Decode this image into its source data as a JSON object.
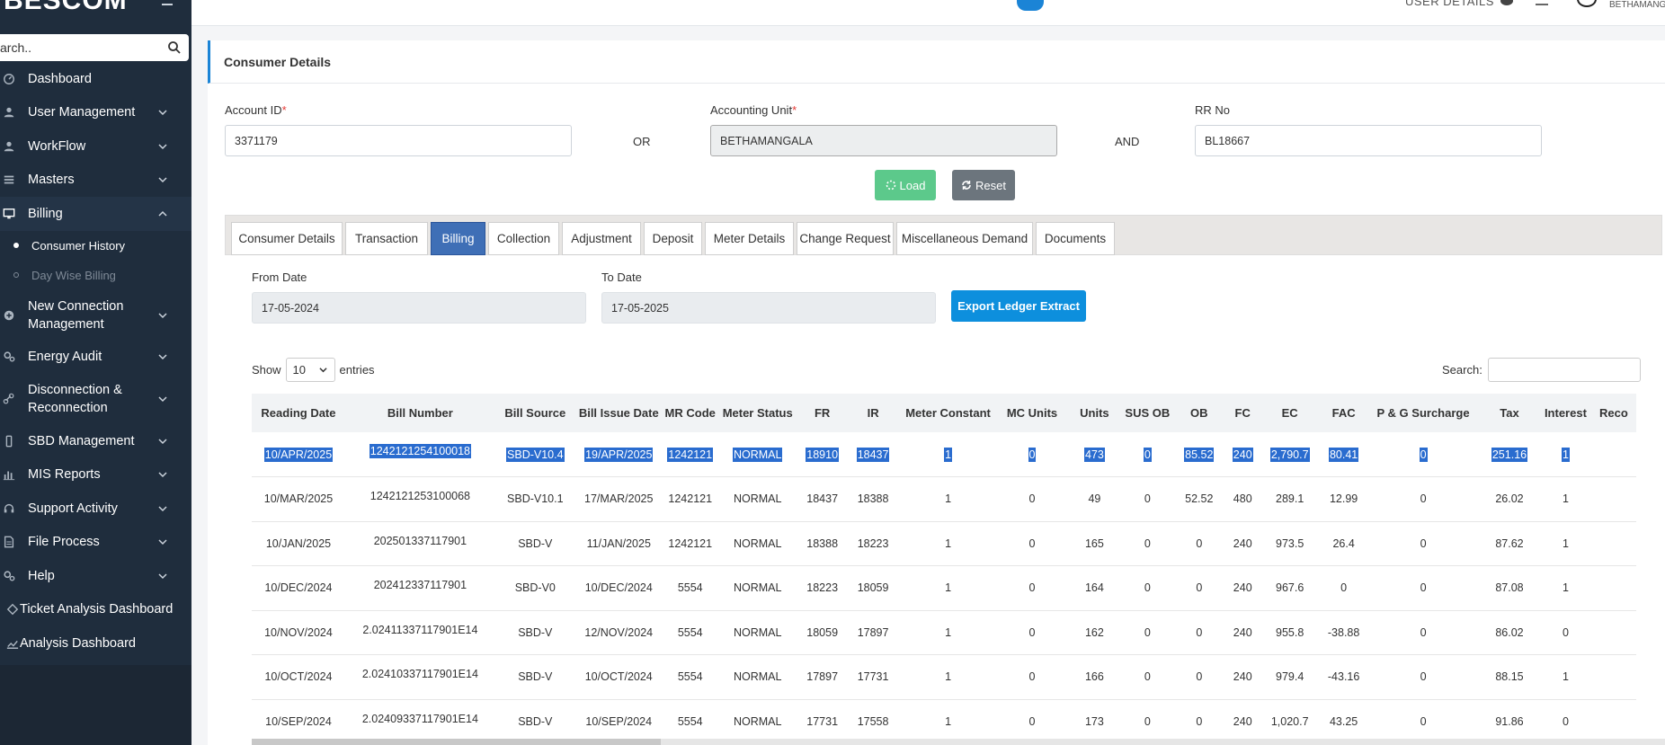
{
  "app": {
    "brand": "BESCOM",
    "search_placeholder": "Search..",
    "search_value": "arch.."
  },
  "header": {
    "user_details": "USER DETAILS",
    "user_name": "BETHAMANGA"
  },
  "sidebar": {
    "items": [
      {
        "label": "Dashboard",
        "icon": "dashboard-icon",
        "chevron": false
      },
      {
        "label": "User Management",
        "icon": "user-icon",
        "chevron": true
      },
      {
        "label": "WorkFlow",
        "icon": "user-icon",
        "chevron": true
      },
      {
        "label": "Masters",
        "icon": "list-icon",
        "chevron": true
      },
      {
        "label": "Billing",
        "icon": "monitor-icon",
        "chevron": true,
        "active": true
      },
      {
        "label": "New Connection Management",
        "icon": "plus-circle-icon",
        "chevron": true
      },
      {
        "label": "Energy Audit",
        "icon": "gears-icon",
        "chevron": true
      },
      {
        "label": "Disconnection & Reconnection",
        "icon": "link-icon",
        "chevron": true
      },
      {
        "label": "SBD Management",
        "icon": "phone-icon",
        "chevron": true
      },
      {
        "label": "MIS Reports",
        "icon": "bar-chart-icon",
        "chevron": true
      },
      {
        "label": "Support Activity",
        "icon": "headset-icon",
        "chevron": true
      },
      {
        "label": "File Process",
        "icon": "file-icon",
        "chevron": true
      },
      {
        "label": "Help",
        "icon": "gears-icon",
        "chevron": true
      },
      {
        "label": "Ticket Analysis Dashboard",
        "icon": "ticket-icon",
        "chevron": false
      },
      {
        "label": "Analysis Dashboard",
        "icon": "line-chart-icon",
        "chevron": false
      }
    ],
    "billing_sub": [
      {
        "label": "Consumer History",
        "current": true
      },
      {
        "label": "Day Wise Billing",
        "current": false
      }
    ]
  },
  "page": {
    "title": "Consumer Details",
    "account_id_label": "Account ID",
    "account_id_value": "3371179",
    "or_label": "OR",
    "accounting_unit_label": "Accounting Unit",
    "accounting_unit_value": "BETHAMANGALA",
    "and_label": "AND",
    "rr_no_label": "RR No",
    "rr_no_value": "BL18667",
    "load_label": "Load",
    "reset_label": "Reset"
  },
  "tabs": [
    "Consumer Details",
    "Transaction",
    "Billing",
    "Collection",
    "Adjustment",
    "Deposit",
    "Meter Details",
    "Change Request",
    "Miscellaneous Demand",
    "Documents"
  ],
  "active_tab": "Billing",
  "billing": {
    "from_date_label": "From Date",
    "from_date_value": "17-05-2024",
    "to_date_label": "To Date",
    "to_date_value": "17-05-2025",
    "export_label": "Export Ledger Extract",
    "show_label": "Show",
    "entries_value": "10",
    "entries_label": "entries",
    "search_label": "Search:"
  },
  "table": {
    "columns": [
      "Reading Date",
      "Bill Number",
      "Bill Source",
      "Bill Issue Date",
      "MR Code",
      "Meter Status",
      "FR",
      "IR",
      "Meter Constant",
      "MC Units",
      "Units",
      "SUS OB",
      "OB",
      "FC",
      "EC",
      "FAC",
      "P & G Surcharge",
      "Tax",
      "Interest",
      "Reco"
    ],
    "rows": [
      [
        "10/APR/2025",
        "1242121254100018",
        "SBD-V10.4",
        "19/APR/2025",
        "1242121",
        "NORMAL",
        "18910",
        "18437",
        "1",
        "0",
        "473",
        "0",
        "85.52",
        "240",
        "2,790.7",
        "80.41",
        "0",
        "251.16",
        "1",
        ""
      ],
      [
        "10/MAR/2025",
        "1242121253100068",
        "SBD-V10.1",
        "17/MAR/2025",
        "1242121",
        "NORMAL",
        "18437",
        "18388",
        "1",
        "0",
        "49",
        "0",
        "52.52",
        "480",
        "289.1",
        "12.99",
        "0",
        "26.02",
        "1",
        ""
      ],
      [
        "10/JAN/2025",
        "202501337117901",
        "SBD-V",
        "11/JAN/2025",
        "1242121",
        "NORMAL",
        "18388",
        "18223",
        "1",
        "0",
        "165",
        "0",
        "0",
        "240",
        "973.5",
        "26.4",
        "0",
        "87.62",
        "1",
        ""
      ],
      [
        "10/DEC/2024",
        "202412337117901",
        "SBD-V0",
        "10/DEC/2024",
        "5554",
        "NORMAL",
        "18223",
        "18059",
        "1",
        "0",
        "164",
        "0",
        "0",
        "240",
        "967.6",
        "0",
        "0",
        "87.08",
        "1",
        ""
      ],
      [
        "10/NOV/2024",
        "2.02411337117901E14",
        "SBD-V",
        "12/NOV/2024",
        "5554",
        "NORMAL",
        "18059",
        "17897",
        "1",
        "0",
        "162",
        "0",
        "0",
        "240",
        "955.8",
        "-38.88",
        "0",
        "86.02",
        "0",
        ""
      ],
      [
        "10/OCT/2024",
        "2.02410337117901E14",
        "SBD-V",
        "10/OCT/2024",
        "5554",
        "NORMAL",
        "17897",
        "17731",
        "1",
        "0",
        "166",
        "0",
        "0",
        "240",
        "979.4",
        "-43.16",
        "0",
        "88.15",
        "1",
        ""
      ],
      [
        "10/SEP/2024",
        "2.02409337117901E14",
        "SBD-V",
        "10/SEP/2024",
        "5554",
        "NORMAL",
        "17731",
        "17558",
        "1",
        "0",
        "173",
        "0",
        "0",
        "240",
        "1,020.7",
        "43.25",
        "0",
        "91.86",
        "0",
        ""
      ]
    ],
    "selected_row": 0
  },
  "colors": {
    "sidebar_bg": "#1f2d3d",
    "accent": "#1b84d6",
    "tab_active": "#3f6fb6",
    "selection": "#2a6ccf",
    "load_btn": "#5cc98b",
    "reset_btn": "#6c757d"
  }
}
